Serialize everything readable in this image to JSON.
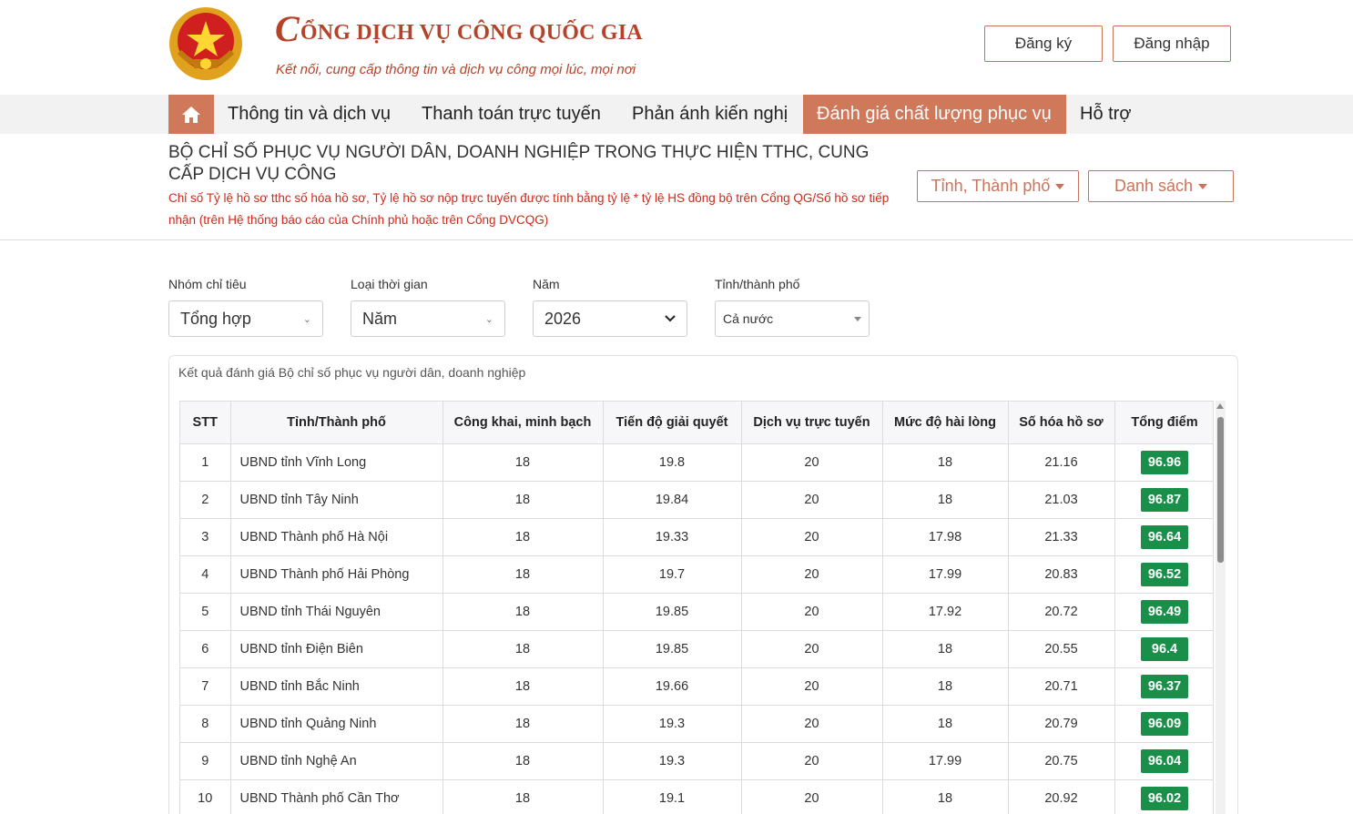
{
  "header": {
    "brand_initial": "C",
    "brand_title_rest": "ỔNG DỊCH VỤ CÔNG QUỐC GIA",
    "brand_subtitle": "Kết nối, cung cấp thông tin và dịch vụ công mọi lúc, mọi nơi",
    "register_label": "Đăng ký",
    "login_label": "Đăng nhập"
  },
  "nav": {
    "items": [
      {
        "label": "Thông tin và dịch vụ"
      },
      {
        "label": "Thanh toán trực tuyến"
      },
      {
        "label": "Phản ánh kiến nghị"
      },
      {
        "label": "Đánh giá chất lượng phục vụ"
      },
      {
        "label": "Hỗ trợ"
      }
    ],
    "active_index": 3
  },
  "page": {
    "title": "BỘ CHỈ SỐ PHỤC VỤ NGƯỜI DÂN, DOANH NGHIỆP TRONG THỰC HIỆN TTHC, CUNG CẤP DỊCH VỤ CÔNG",
    "note": "Chỉ số Tỷ lệ hồ sơ tthc số hóa hồ sơ, Tỷ lệ hồ sơ nộp trực tuyến được tính bằng tỷ lệ * tỷ lệ HS đồng bộ trên Cổng QG/Số hồ sơ tiếp nhận (trên Hệ thống báo cáo của Chính phủ hoặc trên Cổng DVCQG)",
    "province_button": "Tỉnh, Thành phố",
    "list_button": "Danh sách"
  },
  "filters": {
    "group": {
      "label": "Nhóm chỉ tiêu",
      "value": "Tổng hợp"
    },
    "time_type": {
      "label": "Loại thời gian",
      "value": "Năm"
    },
    "year": {
      "label": "Năm",
      "value": "2026"
    },
    "province": {
      "label": "Tỉnh/thành phố",
      "value": "Cả nước"
    }
  },
  "results": {
    "caption": "Kết quả đánh giá Bộ chỉ số phục vụ người dân, doanh nghiệp",
    "columns": [
      "STT",
      "Tỉnh/Thành phố",
      "Công khai, minh bạch",
      "Tiến độ giải quyết",
      "Dịch vụ trực tuyến",
      "Mức độ hài lòng",
      "Số hóa hồ sơ",
      "Tổng điểm"
    ],
    "rows": [
      [
        "1",
        "UBND tỉnh Vĩnh Long",
        "18",
        "19.8",
        "20",
        "18",
        "21.16",
        "96.96"
      ],
      [
        "2",
        "UBND tỉnh Tây Ninh",
        "18",
        "19.84",
        "20",
        "18",
        "21.03",
        "96.87"
      ],
      [
        "3",
        "UBND Thành phố Hà Nội",
        "18",
        "19.33",
        "20",
        "17.98",
        "21.33",
        "96.64"
      ],
      [
        "4",
        "UBND Thành phố Hải Phòng",
        "18",
        "19.7",
        "20",
        "17.99",
        "20.83",
        "96.52"
      ],
      [
        "5",
        "UBND tỉnh Thái Nguyên",
        "18",
        "19.85",
        "20",
        "17.92",
        "20.72",
        "96.49"
      ],
      [
        "6",
        "UBND tỉnh Điện Biên",
        "18",
        "19.85",
        "20",
        "18",
        "20.55",
        "96.4"
      ],
      [
        "7",
        "UBND tỉnh Bắc Ninh",
        "18",
        "19.66",
        "20",
        "18",
        "20.71",
        "96.37"
      ],
      [
        "8",
        "UBND tỉnh Quảng Ninh",
        "18",
        "19.3",
        "20",
        "18",
        "20.79",
        "96.09"
      ],
      [
        "9",
        "UBND tỉnh Nghệ An",
        "18",
        "19.3",
        "20",
        "17.99",
        "20.75",
        "96.04"
      ],
      [
        "10",
        "UBND Thành phố Cần Thơ",
        "18",
        "19.1",
        "20",
        "18",
        "20.92",
        "96.02"
      ]
    ]
  },
  "colors": {
    "brand": "#b5432a",
    "nav_active": "#d0785a",
    "score_badge": "#1a8f4a",
    "note_red": "#d0281b"
  }
}
